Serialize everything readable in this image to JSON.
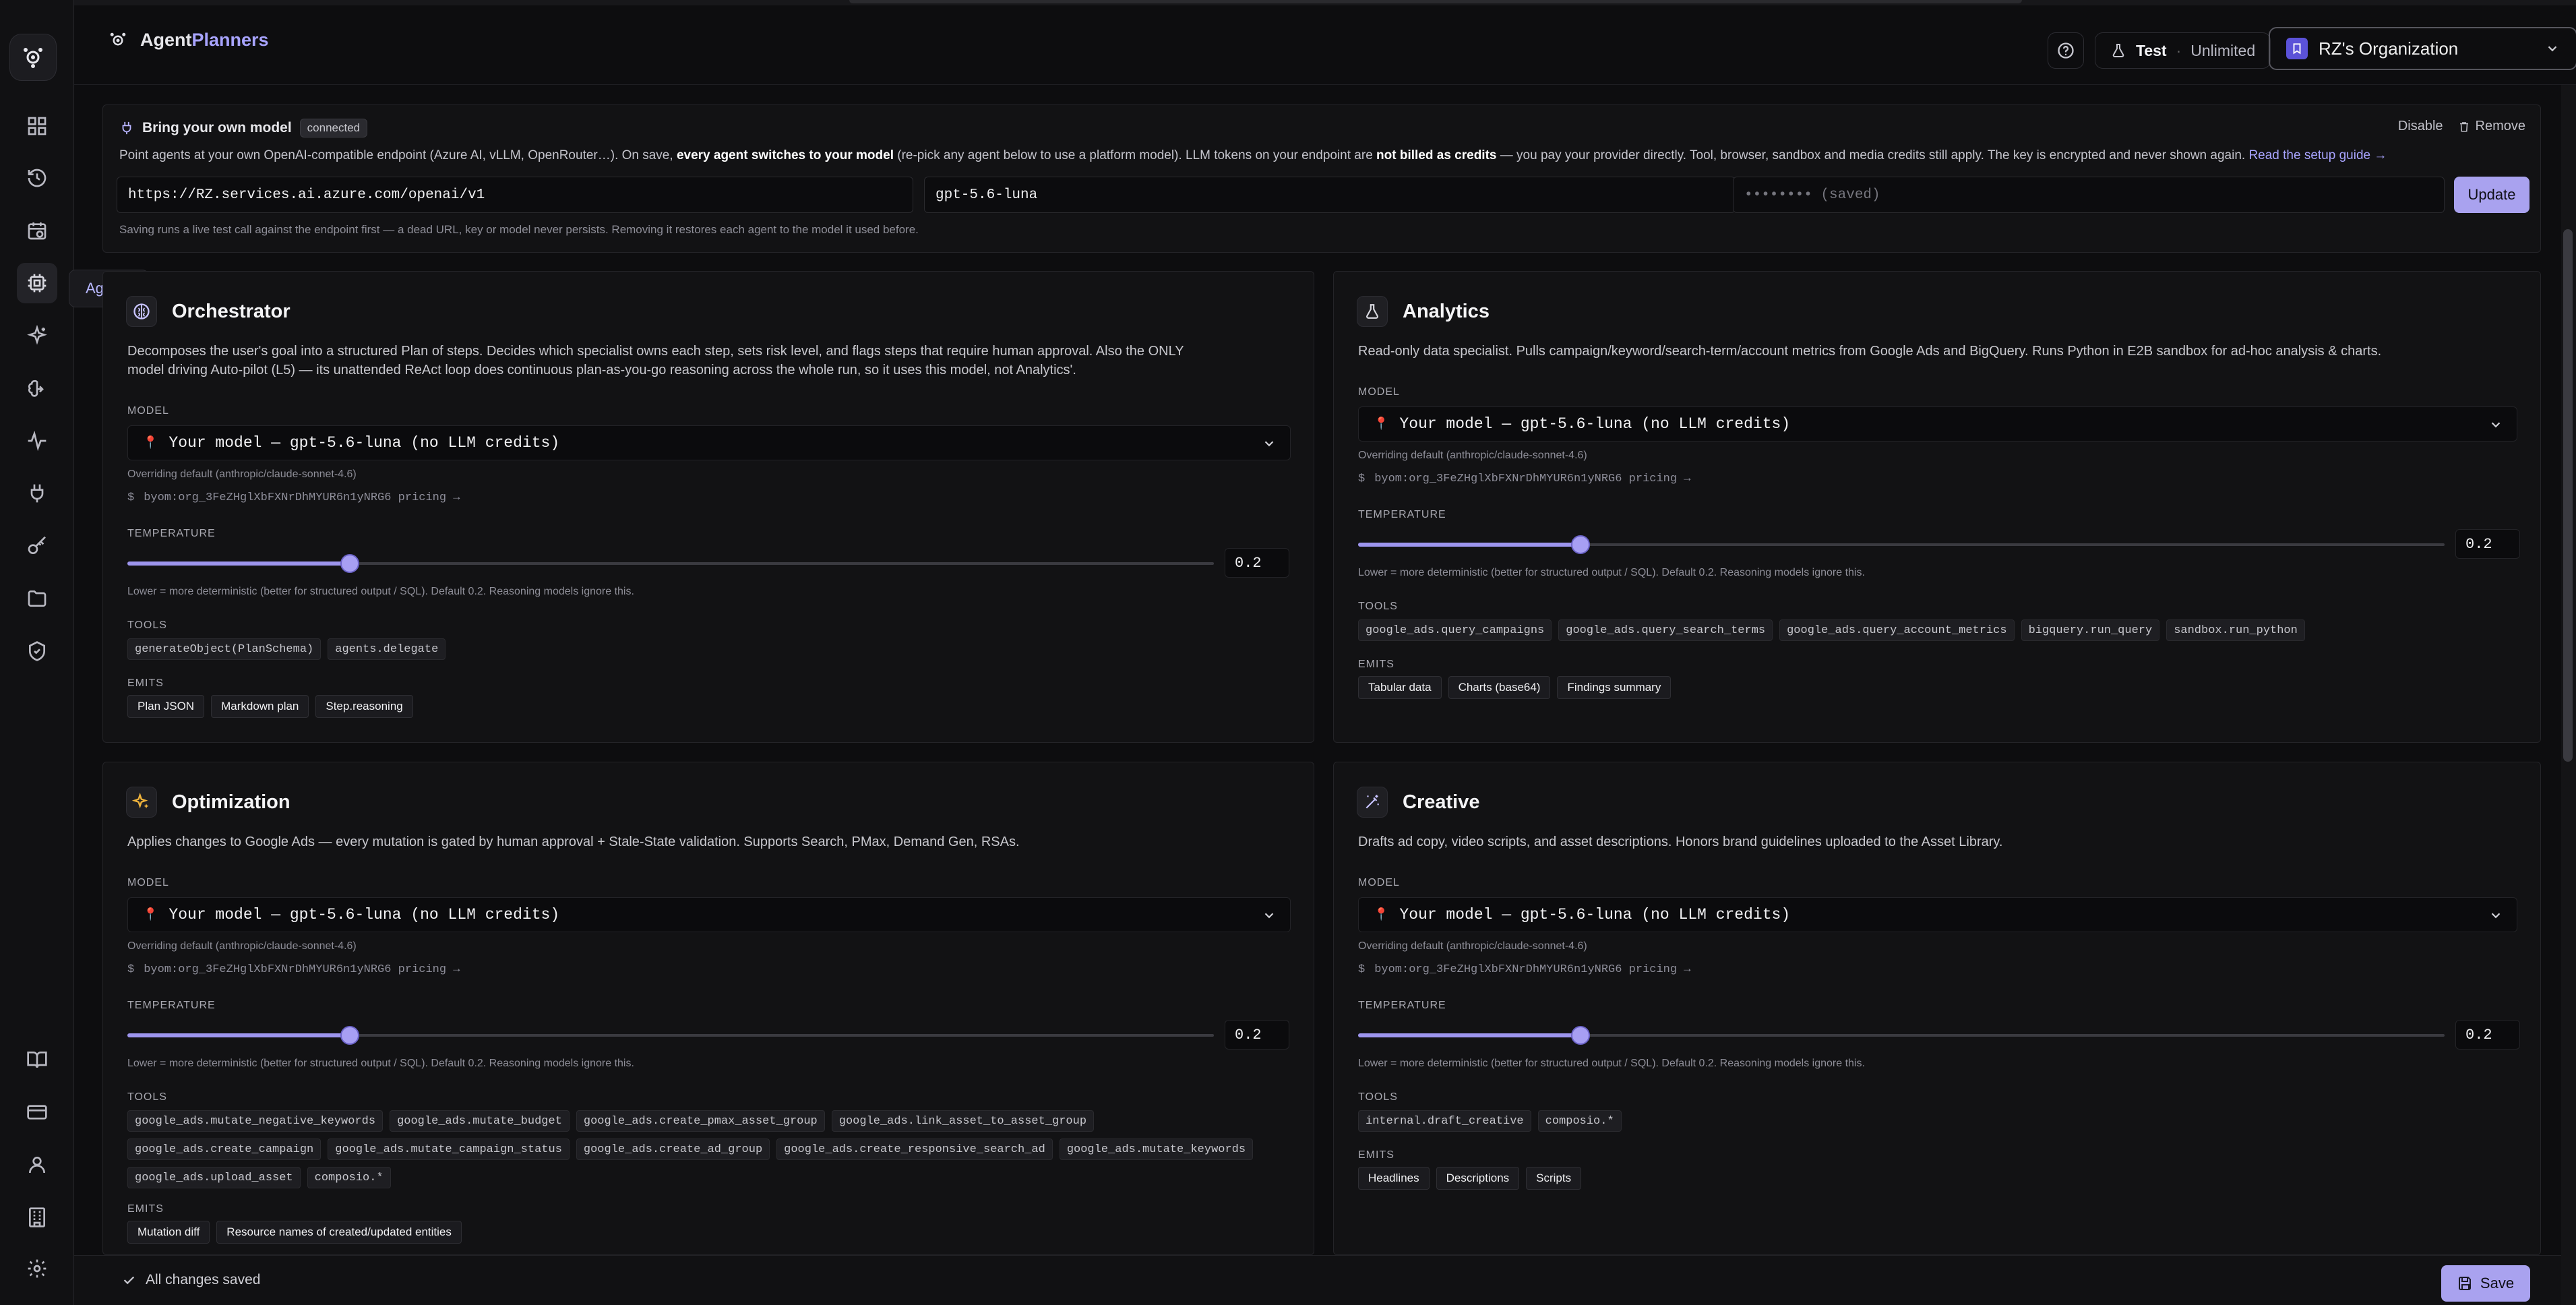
{
  "header": {
    "brand_prefix": "Agent",
    "brand_suffix": "Planners",
    "plan_tier": "Test",
    "plan_sep": "·",
    "plan_limit": "Unlimited",
    "org_name": "RZ's Organization"
  },
  "sidebar": {
    "tooltip": "Agents",
    "items": [
      "dashboard",
      "history",
      "schedule",
      "agents",
      "sparkles",
      "brain",
      "analytics",
      "integrations",
      "keys",
      "files",
      "security",
      "docs",
      "billing",
      "profile",
      "organization",
      "settings"
    ]
  },
  "byom": {
    "title": "Bring your own model",
    "status": "connected",
    "disable_label": "Disable",
    "remove_label": "Remove",
    "desc_1": "Point agents at your own OpenAI-compatible endpoint (Azure AI, vLLM, OpenRouter…). On save, ",
    "desc_b1": "every agent switches to your model",
    "desc_2": " (re-pick any agent below to use a platform model). LLM tokens on your endpoint are ",
    "desc_b2": "not billed as credits",
    "desc_3": " — you pay your provider directly. Tool, browser, sandbox and media credits still apply. The key is encrypted and never shown again. ",
    "desc_link": "Read the setup guide →",
    "endpoint": "https://RZ.services.ai.azure.com/openai/v1",
    "model": "gpt-5.6-luna",
    "key_placeholder": "•••••••• (saved)",
    "update_label": "Update",
    "note": "Saving runs a live test call against the endpoint first — a dead URL, key or model never persists. Removing it restores each agent to the model it used before."
  },
  "labels": {
    "model": "MODEL",
    "temperature": "TEMPERATURE",
    "tools": "TOOLS",
    "emits": "EMITS",
    "temp_hint": "Lower = more deterministic (better for structured output / SQL). Default 0.2. Reasoning models ignore this."
  },
  "agents": [
    {
      "name": "Orchestrator",
      "desc_line1": "Decomposes the user's goal into a structured Plan of steps. Decides which specialist owns each step, sets risk level, and flags steps that require human approval. Also the ONLY",
      "desc_line2": "model driving Auto-pilot (L5) — its unattended ReAct loop does continuous plan-as-you-go reasoning across the whole run, so it uses this model, not Analytics'.",
      "model_value": "Your model — gpt-5.6-luna (no LLM credits)",
      "override": "Overriding default (anthropic/claude-sonnet-4.6)",
      "pricing": "byom:org_3FeZHglXbFXNrDhMYUR6n1yNRG6 pricing →",
      "temperature": 0.2,
      "temperature_text": "0.2",
      "tools": [
        "generateObject(PlanSchema)",
        "agents.delegate"
      ],
      "emits": [
        "Plan JSON",
        "Markdown plan",
        "Step.reasoning"
      ]
    },
    {
      "name": "Analytics",
      "desc_line1": "Read-only data specialist. Pulls campaign/keyword/search-term/account metrics from Google Ads and BigQuery. Runs Python in E2B sandbox for ad-hoc analysis & charts.",
      "desc_line2": "",
      "model_value": "Your model — gpt-5.6-luna (no LLM credits)",
      "override": "Overriding default (anthropic/claude-sonnet-4.6)",
      "pricing": "byom:org_3FeZHglXbFXNrDhMYUR6n1yNRG6 pricing →",
      "temperature": 0.2,
      "temperature_text": "0.2",
      "tools": [
        "google_ads.query_campaigns",
        "google_ads.query_search_terms",
        "google_ads.query_account_metrics",
        "bigquery.run_query",
        "sandbox.run_python"
      ],
      "emits": [
        "Tabular data",
        "Charts (base64)",
        "Findings summary"
      ]
    },
    {
      "name": "Optimization",
      "desc_line1": "Applies changes to Google Ads — every mutation is gated by human approval + Stale-State validation. Supports Search, PMax, Demand Gen, RSAs.",
      "desc_line2": "",
      "model_value": "Your model — gpt-5.6-luna (no LLM credits)",
      "override": "Overriding default (anthropic/claude-sonnet-4.6)",
      "pricing": "byom:org_3FeZHglXbFXNrDhMYUR6n1yNRG6 pricing →",
      "temperature": 0.2,
      "temperature_text": "0.2",
      "tools": [
        "google_ads.mutate_negative_keywords",
        "google_ads.mutate_budget",
        "google_ads.create_pmax_asset_group",
        "google_ads.link_asset_to_asset_group",
        "google_ads.create_campaign",
        "google_ads.mutate_campaign_status",
        "google_ads.create_ad_group",
        "google_ads.create_responsive_search_ad",
        "google_ads.mutate_keywords",
        "google_ads.upload_asset",
        "composio.*"
      ],
      "emits": [
        "Mutation diff",
        "Resource names of created/updated entities"
      ]
    },
    {
      "name": "Creative",
      "desc_line1": "Drafts ad copy, video scripts, and asset descriptions. Honors brand guidelines uploaded to the Asset Library.",
      "desc_line2": "",
      "model_value": "Your model — gpt-5.6-luna (no LLM credits)",
      "override": "Overriding default (anthropic/claude-sonnet-4.6)",
      "pricing": "byom:org_3FeZHglXbFXNrDhMYUR6n1yNRG6 pricing →",
      "temperature": 0.2,
      "temperature_text": "0.2",
      "tools": [
        "internal.draft_creative",
        "composio.*"
      ],
      "emits": [
        "Headlines",
        "Descriptions",
        "Scripts"
      ]
    }
  ],
  "footer": {
    "status": "All changes saved",
    "save_label": "Save"
  },
  "colors": {
    "accent": "#a9a2ef",
    "background": "#0d0d0f",
    "card": "#121214"
  }
}
